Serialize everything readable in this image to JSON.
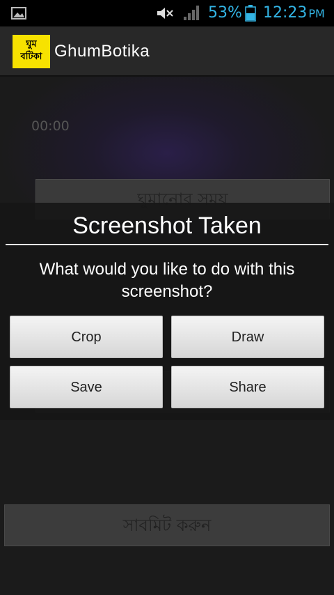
{
  "status_bar": {
    "battery_percent": "53%",
    "time": "12:23",
    "ampm": "PM",
    "accent_color": "#33b5e5"
  },
  "action_bar": {
    "logo_text_line1": "ঘুম",
    "logo_text_line2": "বটিকা",
    "app_title": "GhumBotika"
  },
  "main": {
    "timer_top": "00:00",
    "sleep_time_button": "ঘুমানোর সময়",
    "submit_button": "সাবমিট করুন"
  },
  "dialog": {
    "title": "Screenshot Taken",
    "message": "What would you like to do with this screenshot?",
    "buttons": {
      "crop": "Crop",
      "draw": "Draw",
      "save": "Save",
      "share": "Share"
    }
  }
}
